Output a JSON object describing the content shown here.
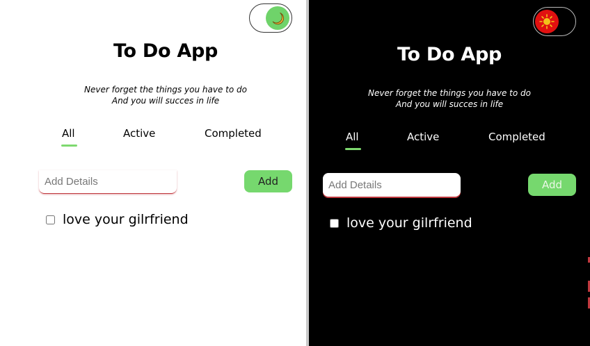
{
  "light": {
    "theme_toggle_icon": "moon-icon",
    "title": "To Do App",
    "tagline_line1": "Never forget the things you have to do",
    "tagline_line2": "And you will succes in life",
    "tabs": [
      {
        "label": "All",
        "selected": true
      },
      {
        "label": "Active",
        "selected": false
      },
      {
        "label": "Completed",
        "selected": false
      }
    ],
    "input_placeholder": "Add Details",
    "input_value": "",
    "add_label": "Add",
    "todos": [
      {
        "text": "love your gilrfriend",
        "checked": false
      }
    ]
  },
  "dark": {
    "theme_toggle_icon": "sun-icon",
    "title": "To Do App",
    "tagline_line1": "Never forget the things you have to do",
    "tagline_line2": "And you will succes in life",
    "tabs": [
      {
        "label": "All",
        "selected": true
      },
      {
        "label": "Active",
        "selected": false
      },
      {
        "label": "Completed",
        "selected": false
      }
    ],
    "input_placeholder": "Add Details",
    "input_value": "",
    "add_label": "Add",
    "todos": [
      {
        "text": "love your gilrfriend",
        "checked": false
      }
    ]
  },
  "colors": {
    "accent_green": "#76d86e",
    "knob_light": "#6fd36a",
    "knob_dark": "#e11010",
    "input_underline": "#c0383e"
  }
}
